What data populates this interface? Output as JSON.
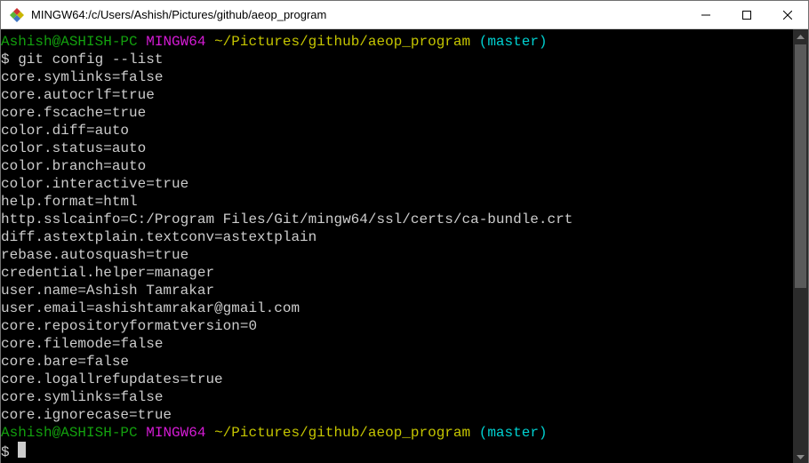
{
  "window": {
    "title": "MINGW64:/c/Users/Ashish/Pictures/github/aeop_program"
  },
  "prompt": {
    "user_host": "Ashish@ASHISH-PC",
    "shell": "MINGW64",
    "path": "~/Pictures/github/aeop_program",
    "branch_open": "(",
    "branch_name": "master",
    "branch_close": ")",
    "symbol": "$"
  },
  "command": "git config --list",
  "output_lines": [
    "core.symlinks=false",
    "core.autocrlf=true",
    "core.fscache=true",
    "color.diff=auto",
    "color.status=auto",
    "color.branch=auto",
    "color.interactive=true",
    "help.format=html",
    "http.sslcainfo=C:/Program Files/Git/mingw64/ssl/certs/ca-bundle.crt",
    "diff.astextplain.textconv=astextplain",
    "rebase.autosquash=true",
    "credential.helper=manager",
    "user.name=Ashish Tamrakar",
    "user.email=ashishtamrakar@gmail.com",
    "core.repositoryformatversion=0",
    "core.filemode=false",
    "core.bare=false",
    "core.logallrefupdates=true",
    "core.symlinks=false",
    "core.ignorecase=true"
  ]
}
